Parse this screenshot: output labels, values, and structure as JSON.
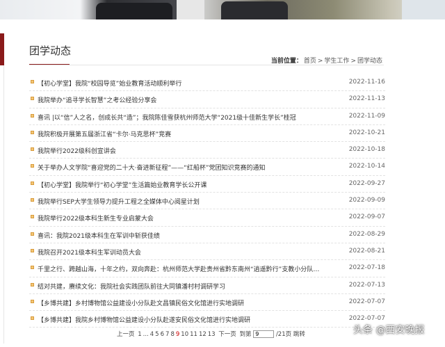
{
  "page": {
    "title": "团学动态",
    "breadcrumb": {
      "label": "当前位置：",
      "items": [
        "首页",
        ">",
        "学生工作",
        ">",
        "团学动态"
      ]
    }
  },
  "news": [
    {
      "text": "【初心学堂】我院“校园导览”始业教育活动顺利举行",
      "date": "2022-11-16"
    },
    {
      "text": "我院举办“追寻学长智慧”之考公经验分享会",
      "date": "2022-11-13"
    },
    {
      "text": "喜讯 |以“信”人之名，创成长共“造”；我院陈佳雪获杭州师范大学“2021级十佳新生学长”桂冠",
      "date": "2022-11-09"
    },
    {
      "text": "我院积极开展第五届浙江省“卡尔·马克思杯”竞赛",
      "date": "2022-10-21"
    },
    {
      "text": "我院举行2022级科创宣讲会",
      "date": "2022-10-18"
    },
    {
      "text": "关于举办人文学院“喜迎党的二十大·奋进新征程”——“红船杯”党团知识竞赛的通知",
      "date": "2022-10-14"
    },
    {
      "text": "【初心学堂】我院举行“初心学堂”生活篇始业教育学长公开课",
      "date": "2022-09-27"
    },
    {
      "text": "我院举行SEP大学生领导力提升工程之全媒体中心阅星计划",
      "date": "2022-09-09"
    },
    {
      "text": "我院举行2022级本科生新生专业启蒙大会",
      "date": "2022-09-07"
    },
    {
      "text": "喜讯：我院2021级本科生在军训中斩获佳绩",
      "date": "2022-08-29"
    },
    {
      "text": "我院召开2021级本科生军训动员大会",
      "date": "2022-08-21"
    },
    {
      "text": "千里之行、跨越山海，十年之约，双向奔赴：杭州师范大学赴贵州省黔东南州“逍遥黔行”支教小分队于高...",
      "date": "2022-07-18"
    },
    {
      "text": "结对共建，赓续文化：我院社会实践团队前往大同镇潘村村调研学习",
      "date": "2022-07-13"
    },
    {
      "text": "【乡博共建】乡村博物馆公益建设小分队赴文昌镇民俗文化馆进行实地调研",
      "date": "2022-07-07"
    },
    {
      "text": "【乡博共建】我院乡村博物馆公益建设小分队赴遂安民俗文化馆进行实地调研",
      "date": "2022-07-07"
    }
  ],
  "pager": {
    "prev": "上一页",
    "pages": [
      "1",
      "...",
      "4",
      "5",
      "6",
      "7",
      "8",
      "9",
      "10",
      "11",
      "12",
      "13"
    ],
    "current": "9",
    "next": "下一页",
    "goto_label": "到第",
    "goto_value": "9",
    "total": "/21页",
    "jump": "跳转"
  },
  "watermark": "头条 @西安晚报",
  "colors": {
    "accent": "#8a1a1a",
    "bullet": "#f3c777",
    "current_page": "#cc0000"
  }
}
